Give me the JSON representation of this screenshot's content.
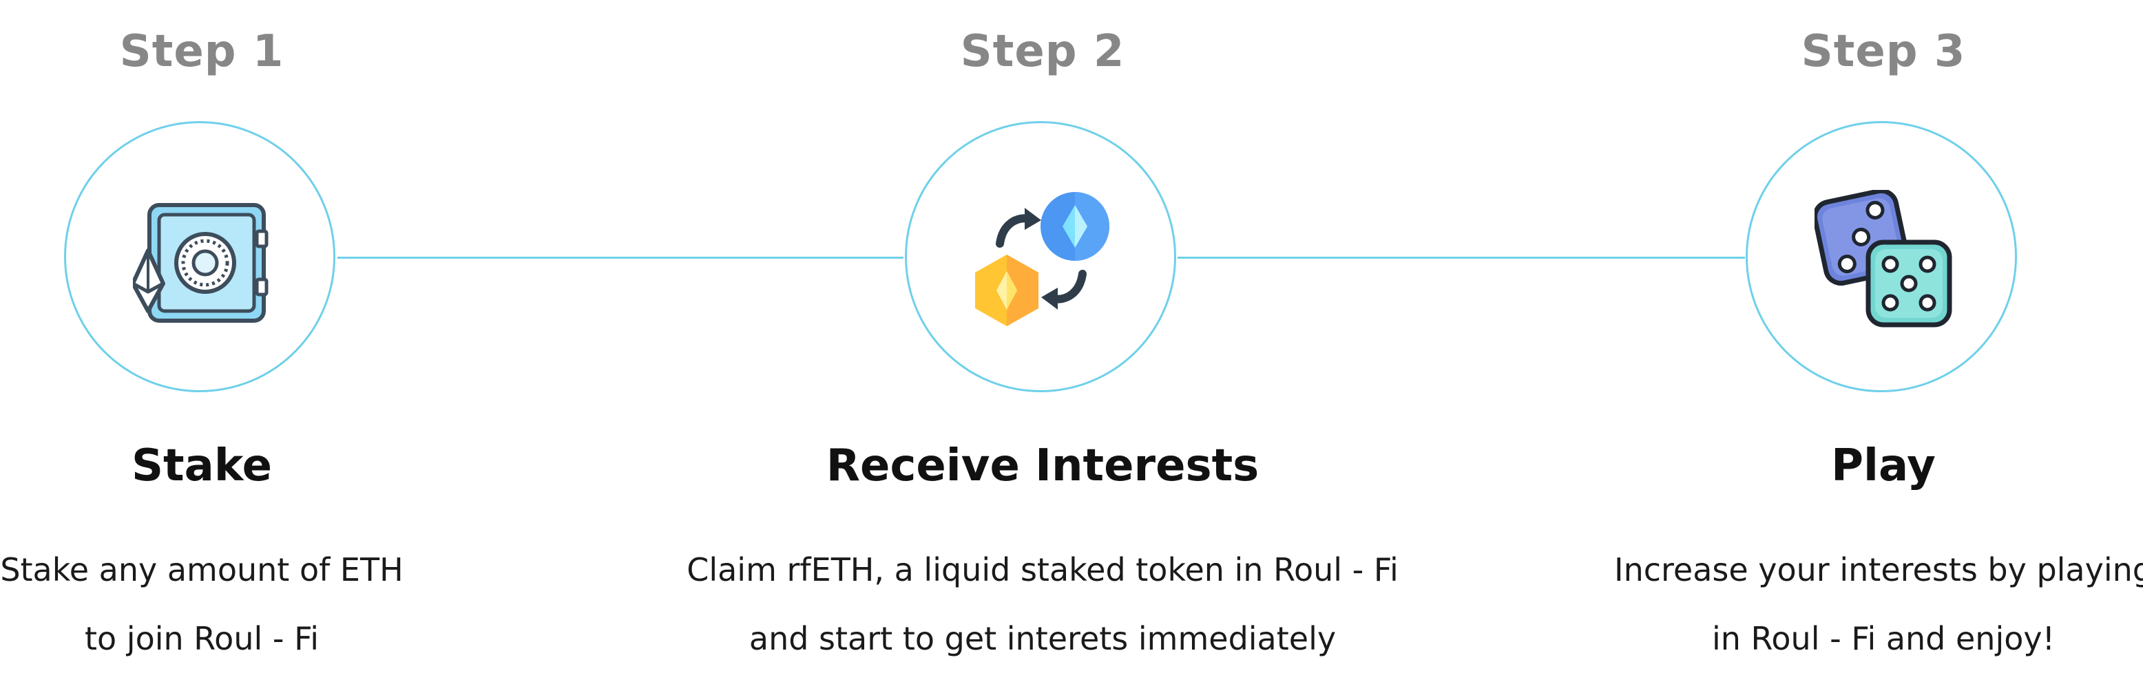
{
  "steps": [
    {
      "label": "Step 1",
      "icon": "eth-safe-icon",
      "title": "Stake",
      "description": [
        "Stake any amount of ETH",
        "to join Roul - Fi"
      ]
    },
    {
      "label": "Step 2",
      "icon": "token-exchange-icon",
      "title": "Receive Interests",
      "description": [
        "Claim rfETH, a liquid staked token in Roul - Fi",
        "and start to get interets immediately"
      ]
    },
    {
      "label": "Step 3",
      "icon": "dice-icon",
      "title": "Play",
      "description": [
        "Increase your interests by playing",
        "in Roul - Fi and enjoy!"
      ]
    }
  ],
  "colors": {
    "connector": "#6fd0ea",
    "step_label": "#878787",
    "title": "#111111",
    "safe_blue": "#8fd8f5",
    "token_blue": "#4b97f2",
    "token_yellow": "#ffc533",
    "dice_purple": "#6e84dc",
    "dice_teal": "#73d6d0"
  }
}
